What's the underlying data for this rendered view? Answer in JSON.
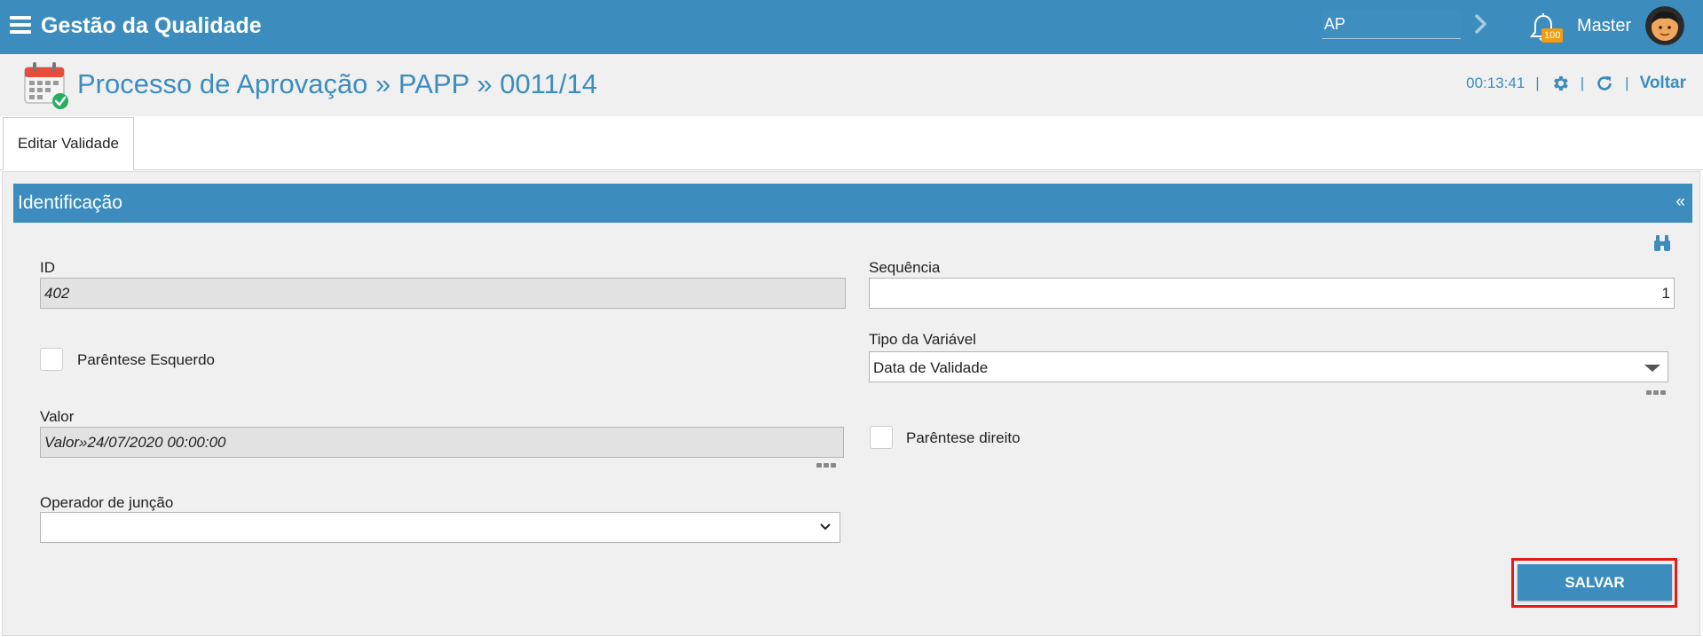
{
  "topbar": {
    "app_title": "Gestão da Qualidade",
    "search_value": "AP",
    "notification_count": "100",
    "user_name": "Master"
  },
  "header": {
    "title": "Processo de Aprovação » PAPP » 0011/14",
    "timer": "00:13:41",
    "back_label": "Voltar"
  },
  "tabs": [
    {
      "label": "Editar Validade",
      "active": true
    }
  ],
  "panel": {
    "title": "Identificação",
    "collapse_glyph": "«"
  },
  "form": {
    "id": {
      "label": "ID",
      "value": "402"
    },
    "sequencia": {
      "label": "Sequência",
      "value": "1"
    },
    "parentese_esquerdo": {
      "label": "Parêntese Esquerdo",
      "checked": false
    },
    "tipo_variavel": {
      "label": "Tipo da Variável",
      "value": "Data de Validade"
    },
    "valor": {
      "label": "Valor",
      "value": "Valor»24/07/2020 00:00:00"
    },
    "parentese_direito": {
      "label": "Parêntese direito",
      "checked": false
    },
    "operador_juncao": {
      "label": "Operador de junção",
      "value": ""
    },
    "save_label": "SALVAR"
  },
  "colors": {
    "primary": "#3c8dbd",
    "badge": "#f39c12",
    "highlight": "#e31b1b",
    "page_bg": "#f0f0f0"
  },
  "icons": [
    "menu-icon",
    "chevron-right-icon",
    "bell-icon",
    "avatar",
    "calendar-check-icon",
    "gear-icon",
    "refresh-icon",
    "binoculars-icon",
    "more-icon",
    "dropdown-caret-icon",
    "chevron-down-icon"
  ]
}
